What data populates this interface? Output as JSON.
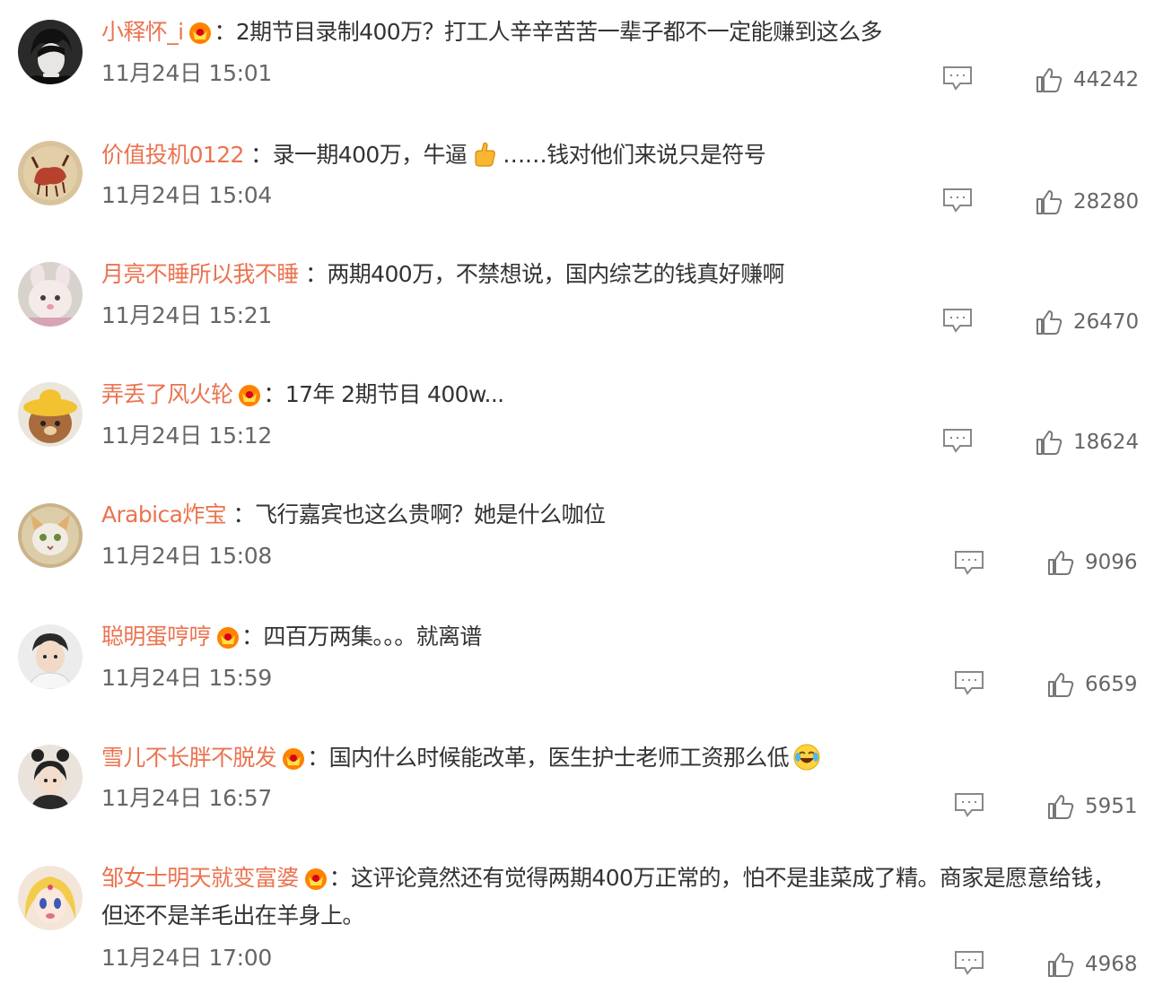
{
  "comments": [
    {
      "username": "小释怀_i",
      "has_badge": true,
      "text": "2期节目录制400万？打工人辛辛苦苦一辈子都不一定能赚到这么多",
      "text_after_emoji": "",
      "time": "11月24日 15:01",
      "likes": "44242"
    },
    {
      "username": "价值投机0122",
      "has_badge": false,
      "text": "录一期400万，牛逼",
      "emoji": "thumbs-up-emoji",
      "text_after_emoji": "……钱对他们来说只是符号",
      "time": "11月24日 15:04",
      "likes": "28280"
    },
    {
      "username": "月亮不睡所以我不睡",
      "has_badge": false,
      "text": "两期400万，不禁想说，国内综艺的钱真好赚啊",
      "text_after_emoji": "",
      "time": "11月24日 15:21",
      "likes": "26470"
    },
    {
      "username": "弄丢了风火轮",
      "has_badge": true,
      "text": "17年 2期节目 400w...",
      "text_after_emoji": "",
      "time": "11月24日 15:12",
      "likes": "18624"
    },
    {
      "username": "Arabica炸宝",
      "has_badge": false,
      "text": "飞行嘉宾也这么贵啊？她是什么咖位",
      "text_after_emoji": "",
      "time": "11月24日 15:08",
      "likes": "9096"
    },
    {
      "username": "聪明蛋哼哼",
      "has_badge": true,
      "text": "四百万两集。。。就离谱",
      "text_after_emoji": "",
      "time": "11月24日 15:59",
      "likes": "6659"
    },
    {
      "username": "雪儿不长胖不脱发",
      "has_badge": true,
      "text": "国内什么时候能改革，医生护士老师工资那么低",
      "emoji": "laugh-cry-emoji",
      "text_after_emoji": "",
      "time": "11月24日 16:57",
      "likes": "5951"
    },
    {
      "username": "邹女士明天就变富婆",
      "has_badge": true,
      "text": "这评论竟然还有觉得两期400万正常的，怕不是韭菜成了精。商家是愿意给钱，",
      "text_line2": "但还不是羊毛出在羊身上。",
      "text_after_emoji": "",
      "time": "11月24日 17:00",
      "likes": "4968"
    }
  ],
  "colors": {
    "username": "#eb7350",
    "text": "#333333",
    "meta": "#666666",
    "icon": "#888888"
  },
  "icons": {
    "reply": "comment-reply-icon",
    "like": "thumbs-up-like-icon",
    "badge": "vip-crown-badge-icon"
  }
}
